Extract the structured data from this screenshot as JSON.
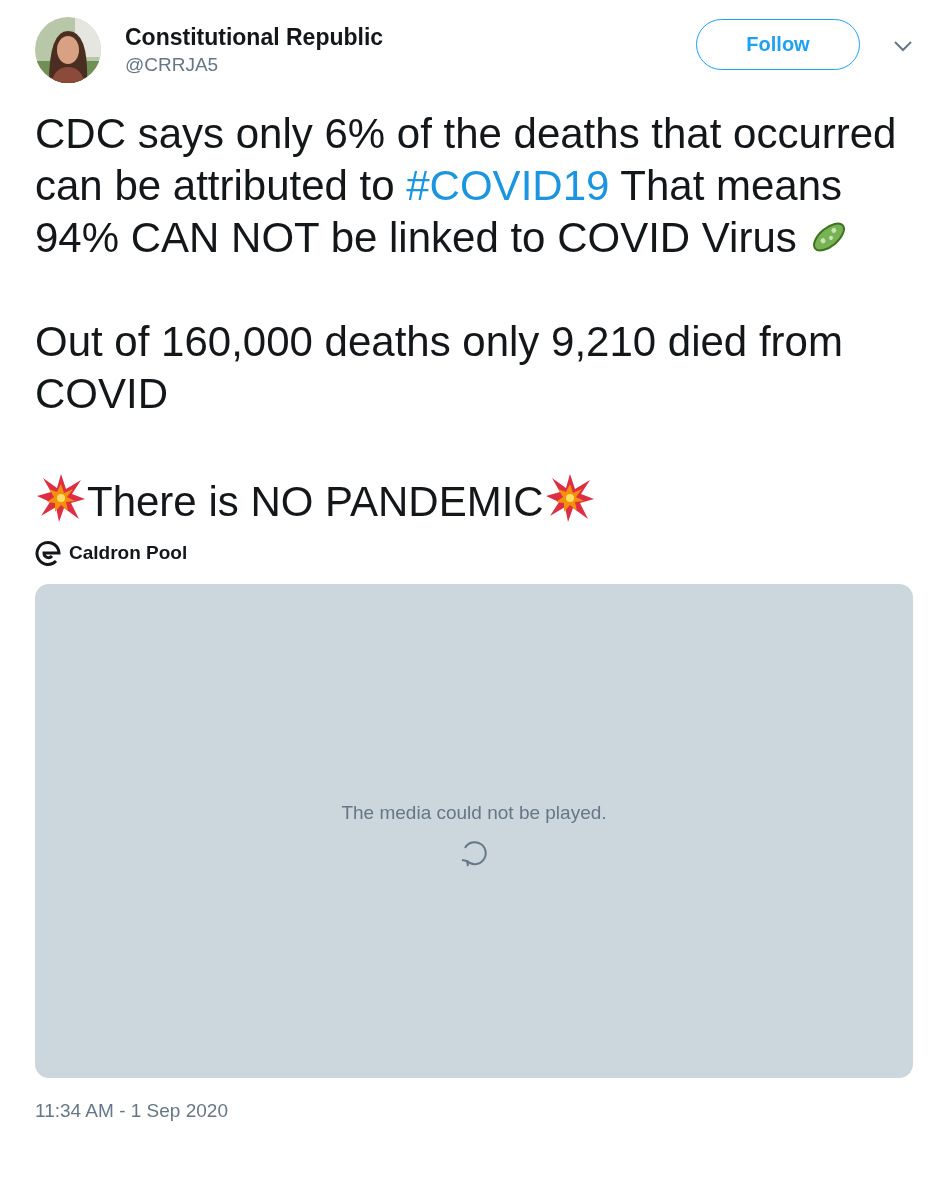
{
  "author": {
    "name": "Constitutional Republic",
    "handle": "@CRRJA5"
  },
  "follow_button": {
    "label": "Follow"
  },
  "paragraphs": [
    {
      "segments": [
        {
          "kind": "text",
          "text": "CDC says only 6% of the deaths that occurred can be attributed to "
        },
        {
          "kind": "hashtag",
          "text": "#COVID19"
        },
        {
          "kind": "text",
          "text": " That means 94% CAN NOT be linked to COVID Virus "
        },
        {
          "kind": "microbe"
        }
      ]
    },
    {
      "segments": [
        {
          "kind": "text",
          "text": "Out of 160,000 deaths only 9,210 died from COVID"
        }
      ]
    },
    {
      "segments": [
        {
          "kind": "collision"
        },
        {
          "kind": "text",
          "text": "There is NO PANDEMIC"
        },
        {
          "kind": "collision"
        }
      ]
    }
  ],
  "source": {
    "name": "Caldron Pool"
  },
  "media": {
    "message": "The media could not be played."
  },
  "timestamp": "11:34 AM - 1 Sep 2020"
}
